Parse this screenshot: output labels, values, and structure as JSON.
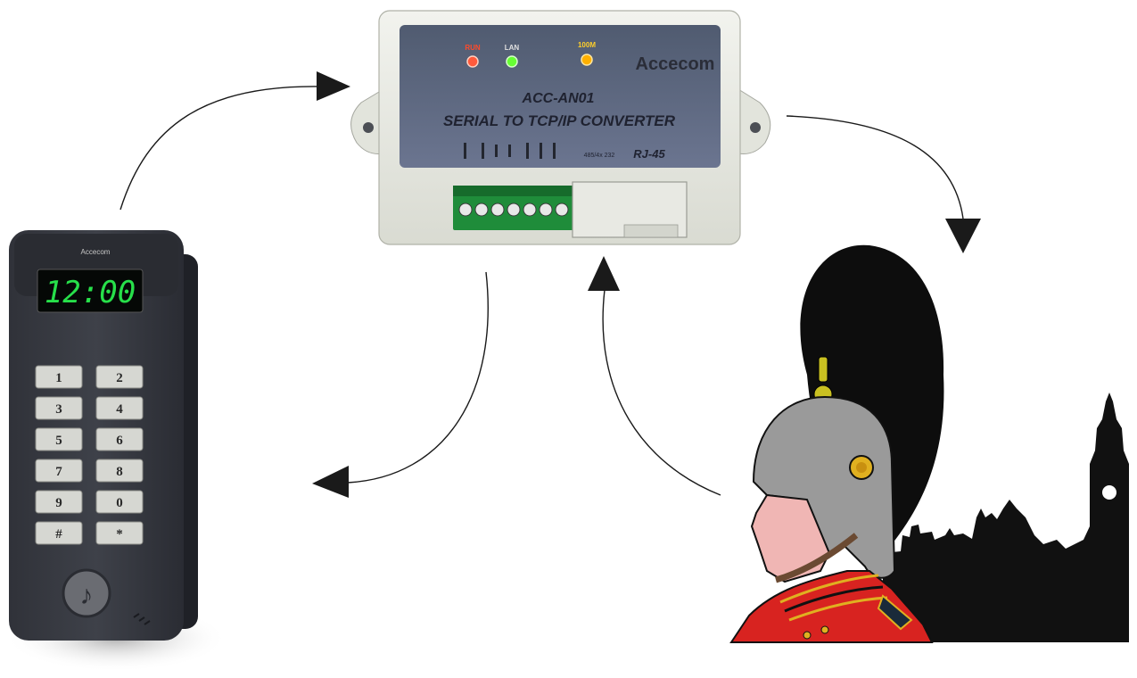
{
  "converter": {
    "brand": "Accecom",
    "model": "ACC-AN01",
    "subtitle": "SERIAL TO TCP/IP CONVERTER",
    "led_labels": [
      "RUN",
      "LAN",
      "100M"
    ],
    "led_colors": [
      "#ff5a3c",
      "#66ff33",
      "#ffb000"
    ],
    "port_label_small": "485/4x 232",
    "port_label": "RJ-45"
  },
  "keypad": {
    "brand": "Accecom",
    "display_time": "12:00",
    "display_color": "#27e04a",
    "keys": [
      "1",
      "2",
      "3",
      "4",
      "5",
      "6",
      "7",
      "8",
      "9",
      "0",
      "#",
      "*"
    ]
  }
}
